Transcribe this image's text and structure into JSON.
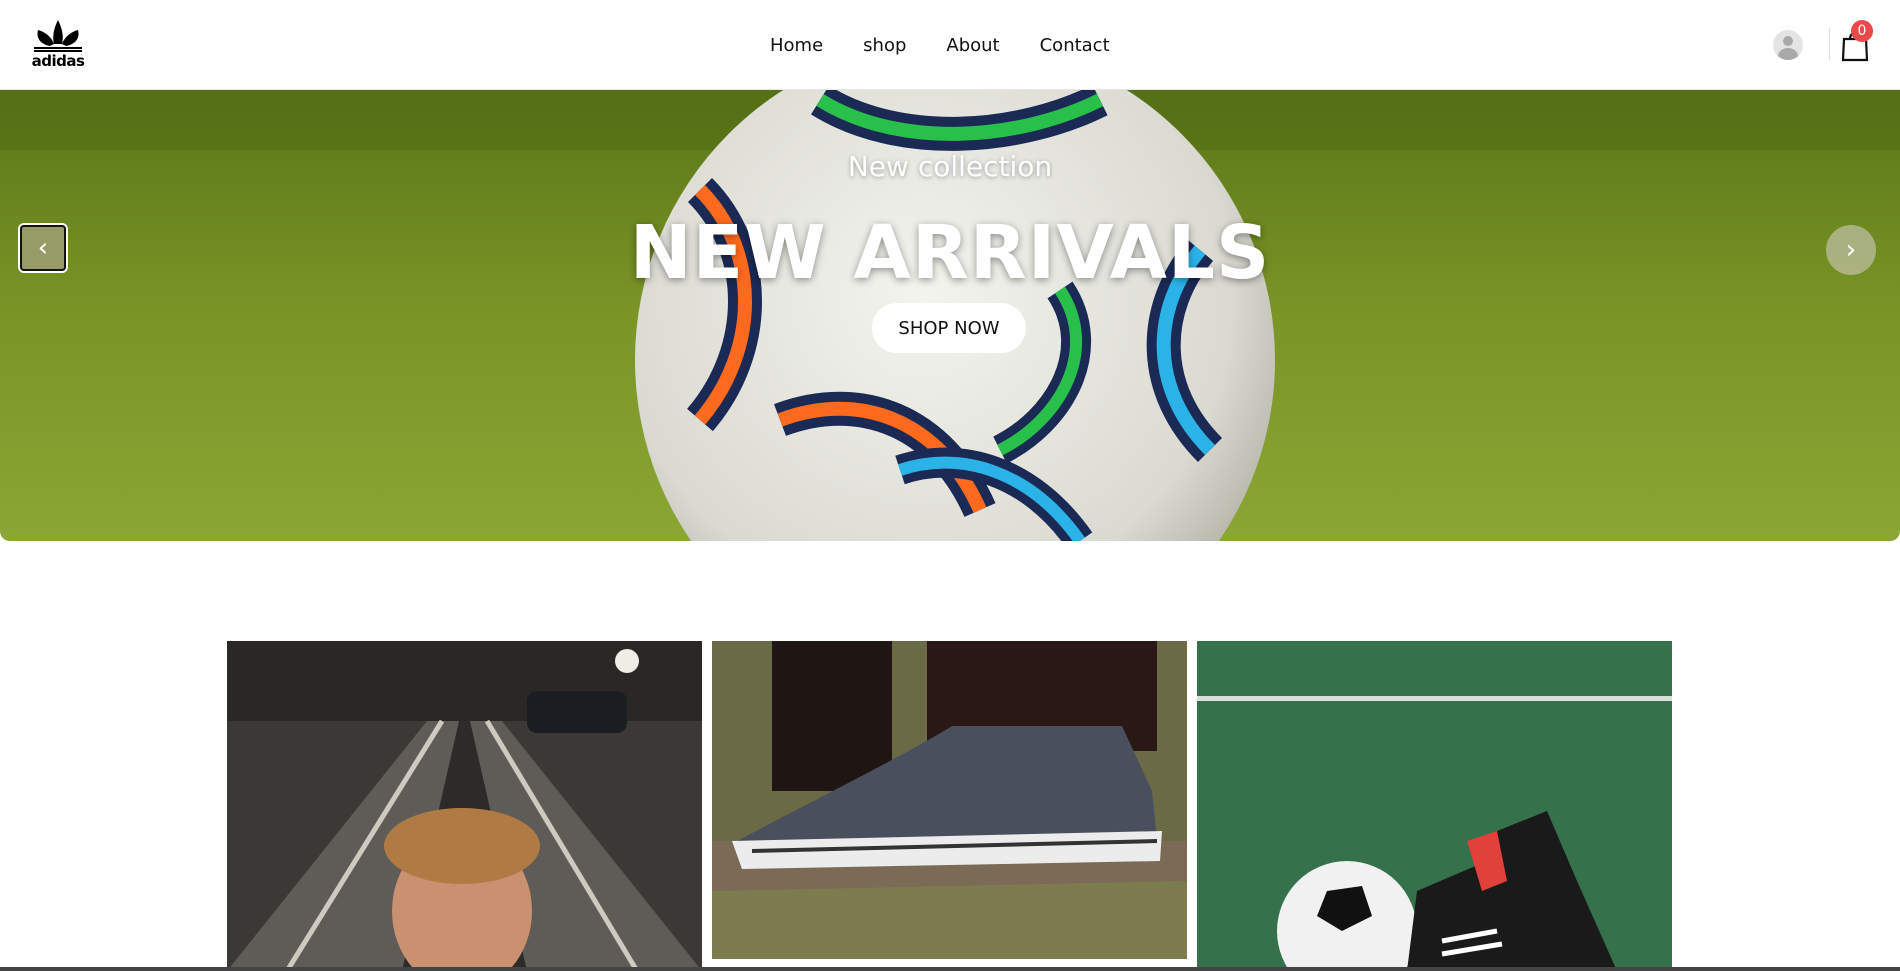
{
  "header": {
    "logo_text": "adidas",
    "nav": [
      "Home",
      "shop",
      "About",
      "Contact"
    ],
    "cart_count": "0",
    "icons": [
      "adidas-trefoil-logo",
      "user-icon",
      "shopping-bag-icon"
    ]
  },
  "hero": {
    "subtitle": "New collection",
    "title": "NEW ARRIVALS",
    "button_label": "SHOP NOW",
    "prev_icon": "chevron-left-icon",
    "next_icon": "chevron-right-icon"
  },
  "products": [
    {
      "image": "young man on road"
    },
    {
      "image": "grey suede sneaker on grass"
    },
    {
      "image": "black football boots with ball on turf"
    }
  ],
  "colors": {
    "accent_badge": "#e84a4a",
    "grass": "#6f8a1e"
  }
}
